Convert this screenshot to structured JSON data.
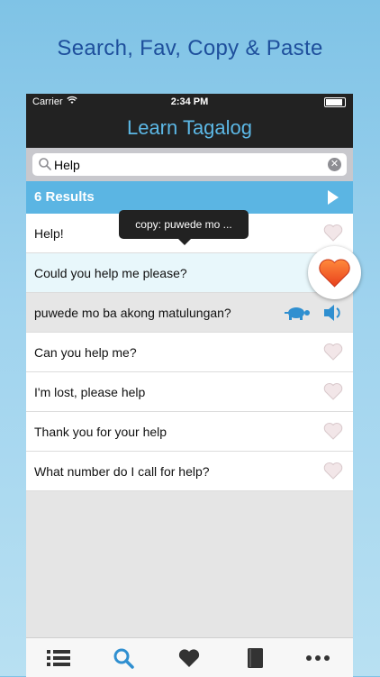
{
  "headline": "Search, Fav, Copy & Paste",
  "status": {
    "carrier": "Carrier",
    "time": "2:34 PM"
  },
  "nav": {
    "title": "Learn Tagalog"
  },
  "search": {
    "value": "Help",
    "clear_symbol": "✕"
  },
  "results": {
    "label": "6 Results"
  },
  "tooltip": {
    "text": "copy: puwede mo ..."
  },
  "rows": [
    {
      "text": "Help!",
      "favorite": false
    },
    {
      "text": "Could you help me please?",
      "favorite": true,
      "selected": true
    },
    {
      "text": "puwede mo ba akong matulungan?",
      "translation": true
    },
    {
      "text": "Can you help me?",
      "favorite": false
    },
    {
      "text": "I'm lost, please help",
      "favorite": false
    },
    {
      "text": "Thank you for your help",
      "favorite": false
    },
    {
      "text": "What number do I call for help?",
      "favorite": false
    }
  ],
  "icons": {
    "search": "magnifier-icon",
    "play": "play-icon",
    "heart": "heart-icon",
    "turtle": "turtle-slow-icon",
    "speaker": "speaker-icon",
    "tabs": [
      "list-icon",
      "search-icon",
      "heart-icon",
      "book-icon",
      "more-icon"
    ]
  },
  "colors": {
    "accent": "#5bb5e3",
    "headline": "#1e4f9c",
    "heart_active": "#f05a28",
    "heart_inactive": "#f2e6e8"
  }
}
